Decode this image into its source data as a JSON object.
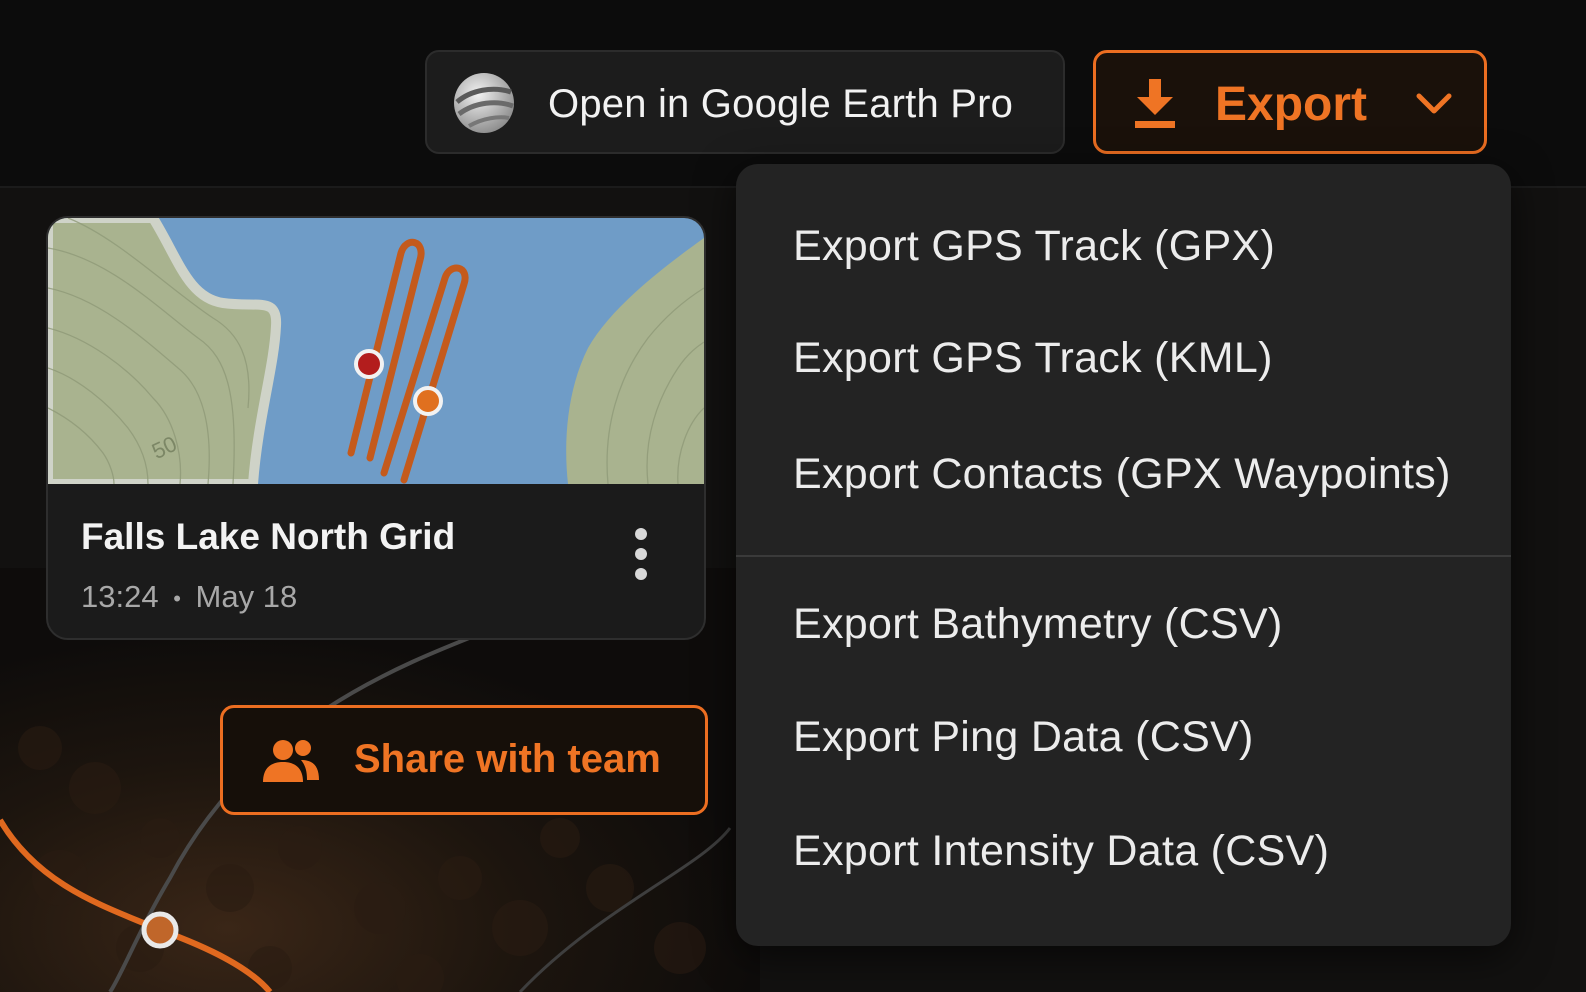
{
  "toolbar": {
    "open_earth_label": "Open in Google Earth Pro",
    "export_label": "Export"
  },
  "export_menu": {
    "group1": [
      "Export GPS Track (GPX)",
      "Export GPS Track (KML)",
      "Export Contacts (GPX Waypoints)"
    ],
    "group2": [
      "Export Bathymetry (CSV)",
      "Export Ping Data (CSV)",
      "Export Intensity Data (CSV)"
    ]
  },
  "survey_card": {
    "title": "Falls Lake North Grid",
    "time": "13:24",
    "date": "May 18",
    "separator": "•",
    "contour_label": "50"
  },
  "share": {
    "label": "Share with team"
  },
  "colors": {
    "accent": "#ec6e21",
    "water": "#6f9cc7",
    "land": "#a9b38f",
    "marker_red": "#b31d1d",
    "menu_bg": "#232323"
  },
  "icons": {
    "earth": "google-earth-globe-icon",
    "download": "download-icon",
    "chevron": "chevron-down-icon",
    "kebab": "more-vertical-icon",
    "people": "people-icon"
  }
}
